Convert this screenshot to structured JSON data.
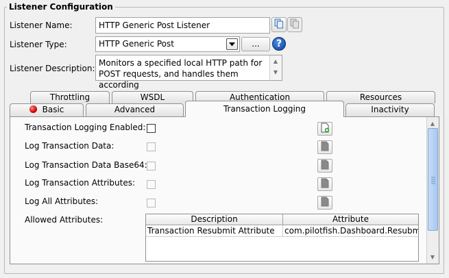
{
  "group": {
    "title": "Listener Configuration"
  },
  "name": {
    "label": "Listener Name:",
    "value": "HTTP Generic Post Listener"
  },
  "type": {
    "label": "Listener Type:",
    "value": "HTTP Generic Post",
    "browse": "...",
    "help": "?"
  },
  "description": {
    "label": "Listener Description:",
    "line1": "Monitors a specified local HTTP path for",
    "line2": "POST requests, and handles them according"
  },
  "tabs_back": [
    {
      "label": "Throttling"
    },
    {
      "label": "WSDL"
    },
    {
      "label": "Authentication"
    },
    {
      "label": "Resources"
    }
  ],
  "tabs_front": [
    {
      "label": "Basic"
    },
    {
      "label": "Advanced"
    },
    {
      "label": "Transaction Logging"
    },
    {
      "label": "Inactivity"
    }
  ],
  "options": [
    {
      "label": "Transaction Logging Enabled:"
    },
    {
      "label": "Log Transaction Data:"
    },
    {
      "label": "Log Transaction Data Base64:"
    },
    {
      "label": "Log Transaction Attributes:"
    },
    {
      "label": "Log All Attributes:"
    }
  ],
  "attributes": {
    "label": "Allowed Attributes:",
    "columns": [
      "Description",
      "Attribute"
    ],
    "rows": [
      {
        "description": "Transaction Resubmit Attribute",
        "attribute": "com.pilotfish.Dashboard.Resubmi..."
      }
    ]
  },
  "icons": {
    "copy": "copy-icon",
    "paste": "paste-icon",
    "help": "help-icon",
    "dropdown": "chevron-down-icon",
    "new_doc": "new-document-icon",
    "doc": "document-icon",
    "status": "red-status-icon"
  },
  "colors": {
    "accent_blue": "#0b3f9c",
    "status_red": "#d00000",
    "thumb": "#a9c8ef"
  }
}
